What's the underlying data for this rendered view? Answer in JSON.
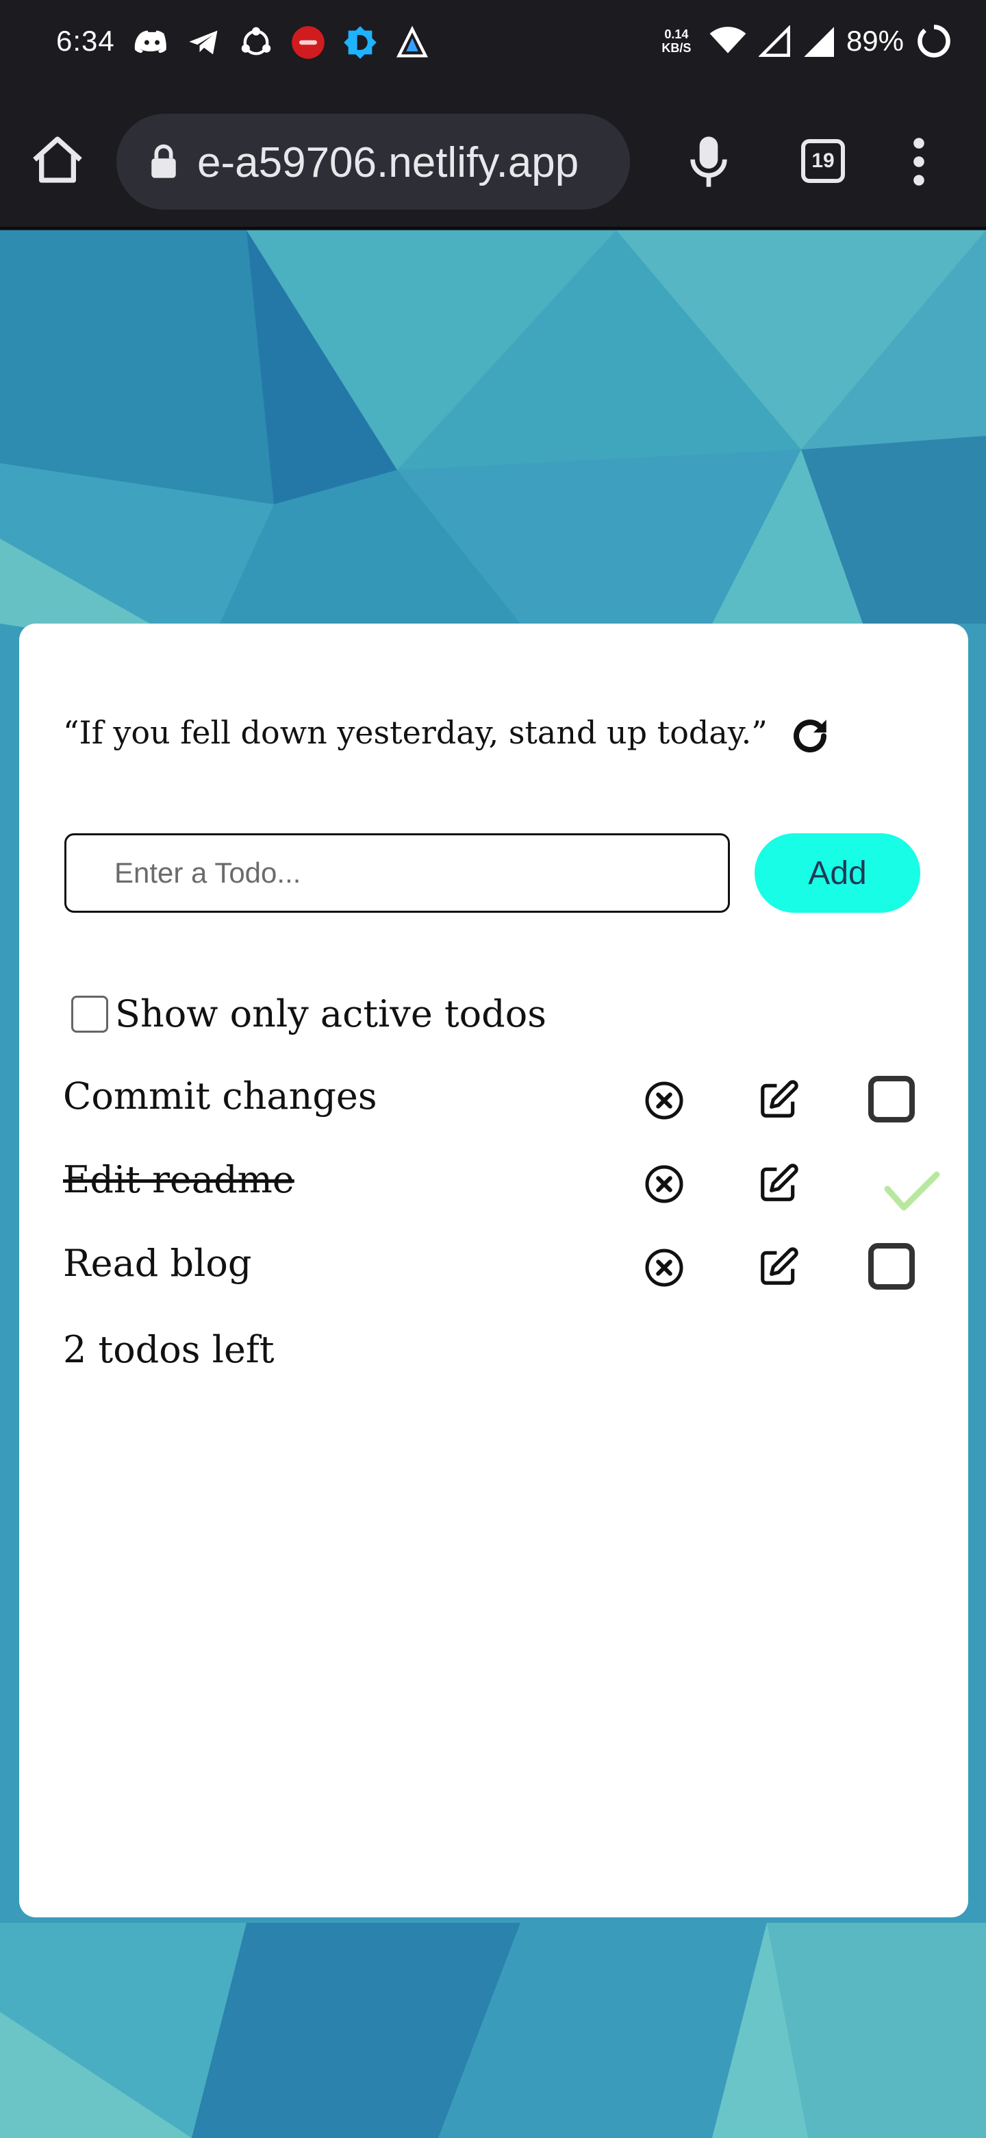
{
  "status_bar": {
    "time": "6:34",
    "net_speed_value": "0.14",
    "net_speed_unit": "KB/S",
    "battery": "89%",
    "left_icons": [
      "discord-icon",
      "telegram-icon",
      "share-icon",
      "app-red-icon",
      "app-blue-icon",
      "app-a-icon"
    ]
  },
  "browser": {
    "url": "e-a59706.netlify.app",
    "tab_count": "19"
  },
  "colors": {
    "add_button": "#18fde6",
    "check_mark": "#b8e8a0",
    "bg_teal": "#3399b8"
  },
  "app": {
    "quote": "“If you fell down yesterday, stand up today.”",
    "input_placeholder": "Enter a Todo...",
    "add_label": "Add",
    "filter_label": "Show only active todos",
    "todos": [
      {
        "text": "Commit changes",
        "completed": false
      },
      {
        "text": "Edit readme",
        "completed": true
      },
      {
        "text": "Read blog",
        "completed": false
      }
    ],
    "todos_left": "2 todos left"
  }
}
